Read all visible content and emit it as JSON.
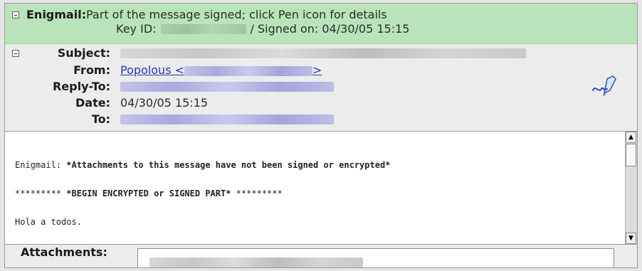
{
  "enigmail": {
    "label": "Enigmail:",
    "line1": "Part of the message signed; click Pen icon for details",
    "keyid_label": "Key ID:",
    "signed_on": "/ Signed on: 04/30/05 15:15"
  },
  "headers": {
    "subject_label": "Subject:",
    "from_label": "From:",
    "from_name": "Popolous <",
    "from_close": ">",
    "replyto_label": "Reply-To:",
    "date_label": "Date:",
    "date_value": "04/30/05 15:15",
    "to_label": "To:"
  },
  "body": {
    "line1_prefix": "Enigmail: ",
    "line1_bold": "*Attachments to this message have not been signed or encrypted*",
    "line2_prefix": "********* ",
    "line2_bold": "*BEGIN ENCRYPTED or SIGNED PART*",
    "line2_suffix": " *********",
    "line3": "Hola a todos."
  },
  "attachments": {
    "label": "Attachments:"
  },
  "icons": [
    "collapse-icon",
    "pen-icon",
    "scroll-up-icon",
    "scroll-down-icon"
  ]
}
